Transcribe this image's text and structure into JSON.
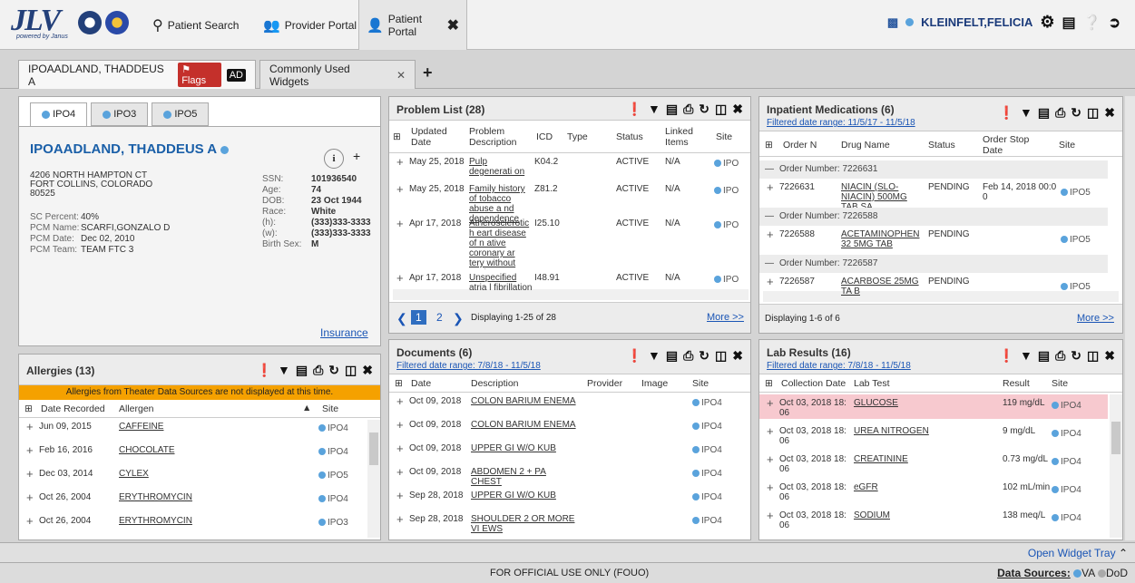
{
  "app": {
    "logo_text": "JLV",
    "logo_sub": "powered by Janus"
  },
  "nav": {
    "patient_search": "Patient Search",
    "provider_portal": "Provider Portal",
    "patient_portal": "Patient Portal"
  },
  "user": {
    "name": "KLEINFELT,FELICIA"
  },
  "tabs": {
    "patient": "IPOAADLAND, THADDEUS A",
    "flags": "Flags",
    "ad": "AD",
    "widgets": "Commonly Used Widgets"
  },
  "demo": {
    "site_tabs": [
      "IPO4",
      "IPO3",
      "IPO5"
    ],
    "name": "IPOAADLAND, THADDEUS A",
    "address1": "4206 NORTH HAMPTON CT",
    "address2": "FORT COLLINS, COLORADO",
    "zip": "80525",
    "sc_label": "SC Percent:",
    "sc": "40%",
    "pcm_name_label": "PCM Name:",
    "pcm_name": "SCARFI,GONZALO D",
    "pcm_date_label": "PCM Date:",
    "pcm_date": "Dec 02, 2010",
    "pcm_team_label": "PCM Team:",
    "pcm_team": "TEAM FTC 3",
    "ssn_label": "SSN:",
    "ssn": "101936540",
    "age_label": "Age:",
    "age": "74",
    "dob_label": "DOB:",
    "dob": "23 Oct 1944",
    "race_label": "Race:",
    "race": "White",
    "h_label": "(h):",
    "h": "(333)333-3333",
    "w_label": "(w):",
    "w": "(333)333-3333",
    "sex_label": "Birth Sex:",
    "sex": "M",
    "insurance": "Insurance"
  },
  "allergies": {
    "title": "Allergies (13)",
    "notice": "Allergies from Theater Data Sources are not displayed at this time.",
    "cols": [
      "Date Recorded",
      "Allergen",
      "Site"
    ],
    "rows": [
      {
        "date": "Jun 09, 2015",
        "allergen": "CAFFEINE",
        "site": "IPO4"
      },
      {
        "date": "Feb 16, 2016",
        "allergen": "CHOCOLATE",
        "site": "IPO4"
      },
      {
        "date": "Dec 03, 2014",
        "allergen": "CYLEX",
        "site": "IPO5"
      },
      {
        "date": "Oct 26, 2004",
        "allergen": "ERYTHROMYCIN",
        "site": "IPO4"
      },
      {
        "date": "Oct 26, 2004",
        "allergen": "ERYTHROMYCIN",
        "site": "IPO3"
      }
    ]
  },
  "problems": {
    "title": "Problem List (28)",
    "cols": [
      "Updated Date",
      "Problem Description",
      "ICD",
      "Type",
      "Status",
      "Linked Items",
      "Site"
    ],
    "rows": [
      {
        "date": "May 25, 2018",
        "desc": "Pulp degenerati on",
        "icd": "K04.2",
        "status": "ACTIVE",
        "linked": "N/A",
        "site": "IPO"
      },
      {
        "date": "May 25, 2018",
        "desc": "Family history of tobacco abuse a nd dependence",
        "icd": "Z81.2",
        "status": "ACTIVE",
        "linked": "N/A",
        "site": "IPO"
      },
      {
        "date": "Apr 17, 2018",
        "desc": "Atherosclerotic h eart disease of n ative coronary ar tery without angi na pectoris",
        "icd": "I25.10",
        "status": "ACTIVE",
        "linked": "N/A",
        "site": "IPO"
      },
      {
        "date": "Apr 17, 2018",
        "desc": "Unspecified atria l fibrillation",
        "icd": "I48.91",
        "status": "ACTIVE",
        "linked": "N/A",
        "site": "IPO"
      }
    ],
    "pages": [
      "1",
      "2"
    ],
    "displaying": "Displaying 1-25 of 28",
    "more": "More >>"
  },
  "meds": {
    "title": "Inpatient Medications (6)",
    "filter": "Filtered date range: 11/5/17 - 11/5/18",
    "cols": [
      "Order N",
      "Drug Name",
      "Status",
      "Order Stop Date",
      "Site"
    ],
    "orders": [
      {
        "group": "Order Number:  7226631",
        "num": "7226631",
        "drug": "NIACIN (SLO-NIACIN) 500MG TAB,SA",
        "status": "PENDING",
        "stop": "Feb 14, 2018 00:0 0",
        "site": "IPO5"
      },
      {
        "group": "Order Number:  7226588",
        "num": "7226588",
        "drug": "ACETAMINOPHEN 32 5MG TAB",
        "status": "PENDING",
        "stop": "",
        "site": "IPO5"
      },
      {
        "group": "Order Number:  7226587",
        "num": "7226587",
        "drug": "ACARBOSE 25MG TA B",
        "status": "PENDING",
        "stop": "",
        "site": "IPO5"
      }
    ],
    "displaying": "Displaying 1-6 of 6",
    "more": "More >>"
  },
  "docs": {
    "title": "Documents (6)",
    "filter": "Filtered date range: 7/8/18 - 11/5/18",
    "cols": [
      "Date",
      "Description",
      "Provider",
      "Image",
      "Site"
    ],
    "rows": [
      {
        "date": "Oct 09, 2018",
        "desc": "COLON BARIUM ENEMA",
        "site": "IPO4"
      },
      {
        "date": "Oct 09, 2018",
        "desc": "COLON BARIUM ENEMA",
        "site": "IPO4"
      },
      {
        "date": "Oct 09, 2018",
        "desc": "UPPER GI W/O KUB",
        "site": "IPO4"
      },
      {
        "date": "Oct 09, 2018",
        "desc": "ABDOMEN 2 + PA CHEST",
        "site": "IPO4"
      },
      {
        "date": "Sep 28, 2018",
        "desc": "UPPER GI W/O KUB",
        "site": "IPO4"
      },
      {
        "date": "Sep 28, 2018",
        "desc": "SHOULDER 2 OR MORE VI EWS",
        "site": "IPO4"
      }
    ]
  },
  "labs": {
    "title": "Lab Results (16)",
    "filter": "Filtered date range: 7/8/18 - 11/5/18",
    "cols": [
      "Collection Date",
      "Lab Test",
      "Result",
      "Site"
    ],
    "rows": [
      {
        "date": "Oct 03, 2018 18: 06",
        "test": "GLUCOSE",
        "result": "119 mg/dL",
        "site": "IPO4"
      },
      {
        "date": "Oct 03, 2018 18: 06",
        "test": "UREA NITROGEN",
        "result": "9 mg/dL",
        "site": "IPO4"
      },
      {
        "date": "Oct 03, 2018 18: 06",
        "test": "CREATININE",
        "result": "0.73 mg/dL",
        "site": "IPO4"
      },
      {
        "date": "Oct 03, 2018 18: 06",
        "test": "eGFR",
        "result": "102 mL/min",
        "site": "IPO4"
      },
      {
        "date": "Oct 03, 2018 18: 06",
        "test": "SODIUM",
        "result": "138 meq/L",
        "site": "IPO4"
      }
    ],
    "highlight": "#f7c9cf"
  },
  "tray": "Open Widget Tray",
  "footer": {
    "fouo": "FOR OFFICIAL USE ONLY (FOUO)",
    "sources_label": "Data Sources:",
    "va": "VA",
    "dod": "DoD"
  }
}
